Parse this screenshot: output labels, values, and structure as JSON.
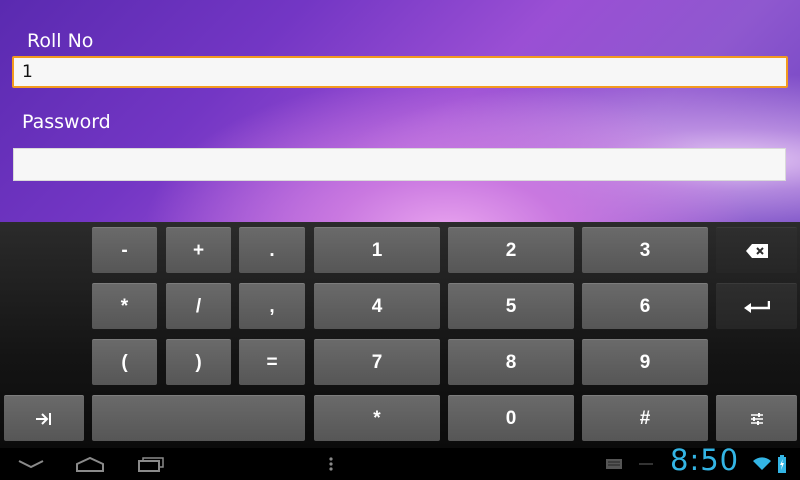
{
  "form": {
    "rollno_label": "Roll No",
    "rollno_value": "1",
    "password_label": "Password",
    "password_value": ""
  },
  "keyboard": {
    "rows": [
      [
        "-",
        "+",
        ".",
        "1",
        "2",
        "3"
      ],
      [
        "*",
        "/",
        ",",
        "4",
        "5",
        "6"
      ],
      [
        "(",
        ")",
        "=",
        "7",
        "8",
        "9"
      ],
      [
        "*",
        "0",
        "#"
      ]
    ],
    "special_keys": {
      "delete": "backspace-icon",
      "enter": "enter-icon",
      "tab": "tab-icon",
      "settings": "settings-sliders-icon",
      "space": ""
    }
  },
  "system_bar": {
    "time": "8:50",
    "icons": [
      "back-icon",
      "home-icon",
      "recent-apps-icon",
      "menu-icon",
      "keyboard-icon",
      "wifi-icon",
      "battery-icon"
    ],
    "clock_color": "#33b5e5"
  },
  "colors": {
    "focus_border": "#f39a1f",
    "key_background": "#5f5f5f"
  }
}
